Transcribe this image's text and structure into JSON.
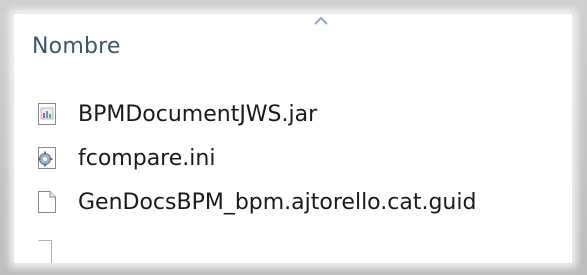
{
  "column_header": {
    "label": "Nombre",
    "sort_icon": "chevron-up-icon"
  },
  "files": [
    {
      "name": "BPMDocumentJWS.jar",
      "icon": "jar-file-icon"
    },
    {
      "name": "fcompare.ini",
      "icon": "settings-file-icon"
    },
    {
      "name": "GenDocsBPM_bpm.ajtorello.cat.guid",
      "icon": "blank-file-icon"
    }
  ],
  "colors": {
    "header_text": "#3b5573",
    "file_text": "#1a1a1a",
    "frame": "#c6c6c6"
  }
}
